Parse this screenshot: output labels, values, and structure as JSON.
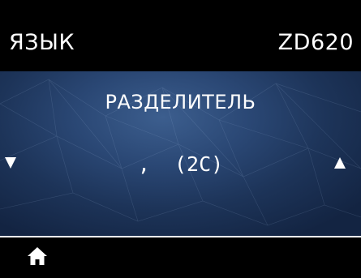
{
  "header": {
    "menu_title": "ЯЗЫК",
    "model": "ZD620"
  },
  "setting": {
    "name": "РАЗДЕЛИТЕЛЬ",
    "value": ",  (2C)"
  },
  "navigation": {
    "prev_icon": "down-triangle-icon",
    "next_icon": "up-triangle-icon",
    "home_icon": "home-icon"
  },
  "colors": {
    "background": "#000000",
    "panel_blue": "#2a4774",
    "text": "#ffffff"
  }
}
